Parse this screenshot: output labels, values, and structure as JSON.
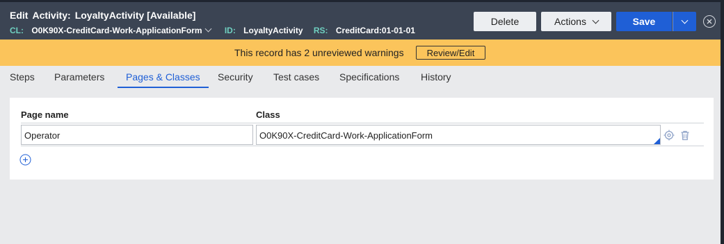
{
  "header": {
    "title_edit": "Edit",
    "title_type": "Activity:",
    "title_name": "LoyaltyActivity",
    "title_status": "[Available]",
    "cl_label": "CL:",
    "cl_value": "O0K90X-CreditCard-Work-ApplicationForm",
    "id_label": "ID:",
    "id_value": "LoyaltyActivity",
    "rs_label": "RS:",
    "rs_value": "CreditCard:01-01-01"
  },
  "toolbar": {
    "delete_label": "Delete",
    "actions_label": "Actions",
    "save_label": "Save"
  },
  "banner": {
    "message": "This record has 2 unreviewed warnings",
    "button_label": "Review/Edit"
  },
  "tabs": [
    {
      "label": "Steps"
    },
    {
      "label": "Parameters"
    },
    {
      "label": "Pages & Classes",
      "active": true
    },
    {
      "label": "Security"
    },
    {
      "label": "Test cases"
    },
    {
      "label": "Specifications"
    },
    {
      "label": "History"
    }
  ],
  "table": {
    "columns": [
      "Page name",
      "Class"
    ],
    "rows": [
      {
        "page_name": "Operator",
        "class": "O0K90X-CreditCard-Work-ApplicationForm"
      }
    ]
  },
  "colors": {
    "header_bg": "#3b4453",
    "accent": "#1f5fd6",
    "banner_bg": "#fbc45b",
    "label_teal": "#6fd0c0"
  },
  "icons": [
    "chevron-down-icon",
    "close-icon",
    "target-icon",
    "trash-icon",
    "add-circle-icon"
  ]
}
